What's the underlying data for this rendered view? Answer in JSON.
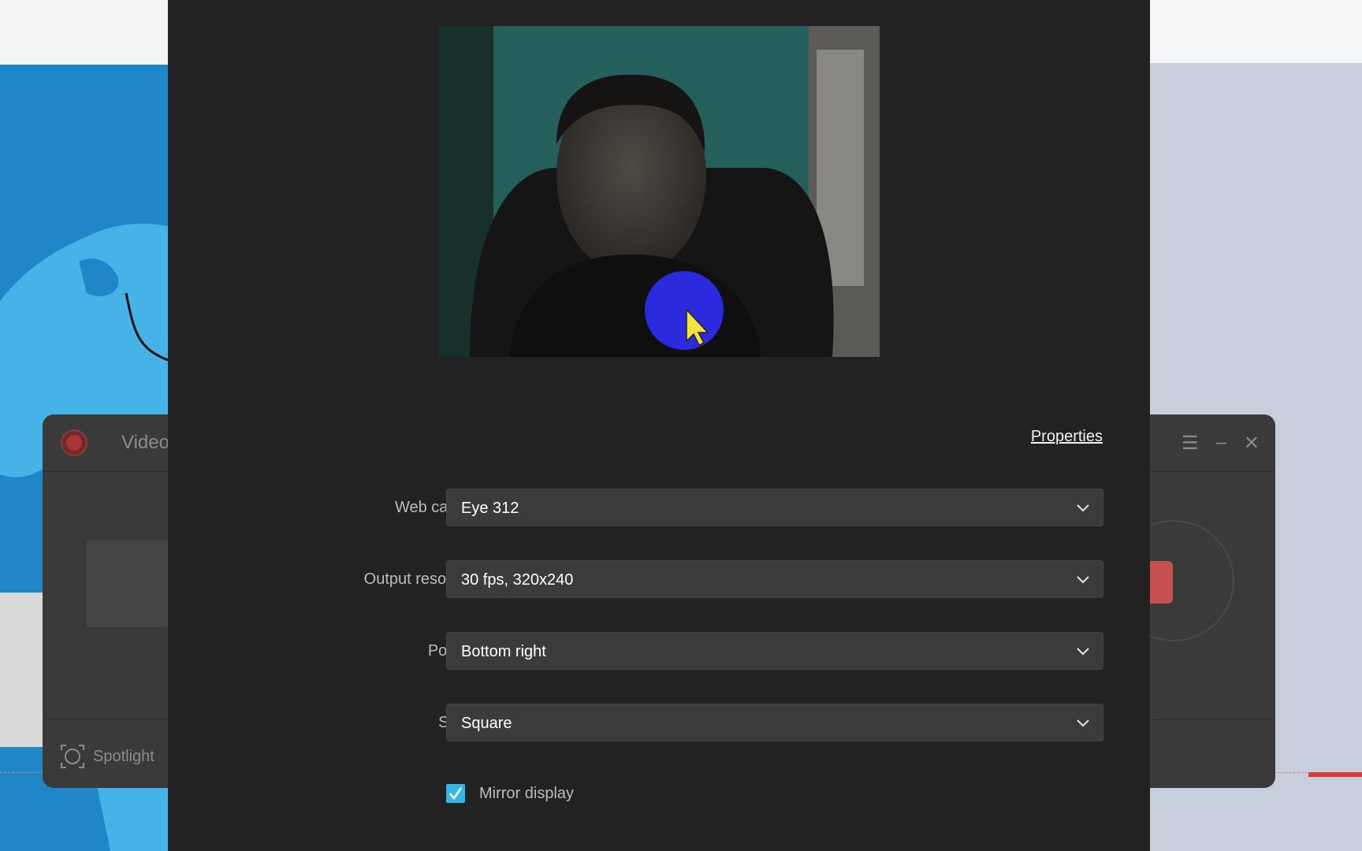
{
  "background_window": {
    "title": "Video",
    "spotlight_label": "Spotlight"
  },
  "dialog": {
    "properties_link": "Properties",
    "fields": {
      "web_camera": {
        "label": "Web camera",
        "value": "Eye 312"
      },
      "output_resolution": {
        "label": "Output resolution",
        "value": "30 fps, 320x240"
      },
      "position": {
        "label": "Position",
        "value": "Bottom right"
      },
      "shape": {
        "label": "Shape",
        "value": "Square"
      }
    },
    "mirror_display": {
      "label": "Mirror display",
      "checked": true
    }
  },
  "colors": {
    "dialog_bg": "#222222",
    "select_bg": "#3b3b3b",
    "checkbox_accent": "#33b6e8",
    "cursor_highlight": "#2f2cf0"
  },
  "icons": [
    "chevron-down-icon",
    "checkmark-icon",
    "mouse-pointer-icon",
    "recorder-logo-icon",
    "spotlight-icon",
    "menu-icon",
    "minimize-icon",
    "close-icon"
  ]
}
